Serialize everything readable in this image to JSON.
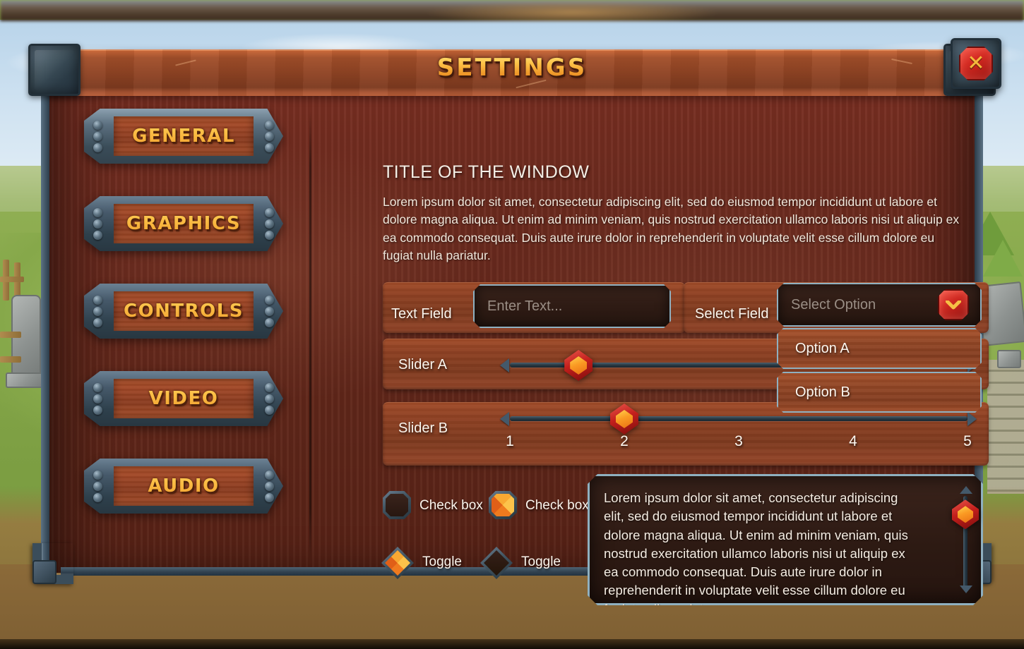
{
  "window": {
    "title": "SETTINGS",
    "close_label": "✕"
  },
  "sidebar": {
    "items": [
      {
        "label": "GENERAL",
        "selected": true
      },
      {
        "label": "GRAPHICS",
        "selected": false
      },
      {
        "label": "CONTROLS",
        "selected": false
      },
      {
        "label": "VIDEO",
        "selected": false
      },
      {
        "label": "AUDIO",
        "selected": false
      }
    ]
  },
  "content": {
    "heading": "TITLE OF THE WINDOW",
    "body": "Lorem ipsum dolor sit amet, consectetur adipiscing elit, sed do eiusmod tempor incididunt ut labore et dolore magna aliqua. Ut enim ad minim veniam, quis nostrud exercitation ullamco laboris nisi ut aliquip ex ea commodo consequat. Duis aute irure dolor in reprehenderit in voluptate velit esse cillum dolore eu fugiat nulla pariatur."
  },
  "text_field": {
    "label": "Text Field",
    "placeholder": "Enter Text...",
    "value": ""
  },
  "select_field": {
    "label": "Select Field",
    "placeholder": "Select Option",
    "selected": "",
    "expanded": true,
    "options": [
      {
        "label": "Option A"
      },
      {
        "label": "Option B"
      }
    ]
  },
  "slider_a": {
    "label": "Slider A",
    "value": 1.5,
    "min": 1,
    "max": 5,
    "position_pct": 15
  },
  "slider_b": {
    "label": "Slider B",
    "value": 2,
    "min": 1,
    "max": 5,
    "position_pct": 25,
    "ticks": [
      "1",
      "2",
      "3",
      "4",
      "5"
    ]
  },
  "checkboxes": [
    {
      "label": "Check box",
      "checked": false
    },
    {
      "label": "Check box",
      "checked": true
    }
  ],
  "toggles": [
    {
      "label": "Toggle",
      "on": true
    },
    {
      "label": "Toggle",
      "on": false
    }
  ],
  "text_panel": {
    "body": "Lorem ipsum dolor sit amet, consectetur adipiscing elit, sed do eiusmod tempor incididunt ut labore et dolore magna aliqua. Ut enim ad minim veniam, quis nostrud exercitation ullamco laboris nisi ut aliquip ex ea commodo consequat. Duis aute irure dolor in reprehenderit in voluptate velit esse cillum dolore eu fugiat nulla pariatur.",
    "scroll_pct": 8
  },
  "colors": {
    "wood": "#8e4123",
    "panel_dark": "#2d1a13",
    "steel": "#3d505c",
    "gold": "#fcc248",
    "gem_red": "#d02a22",
    "gem_orange": "#f8a832",
    "border_blue": "#8fb0c0"
  }
}
